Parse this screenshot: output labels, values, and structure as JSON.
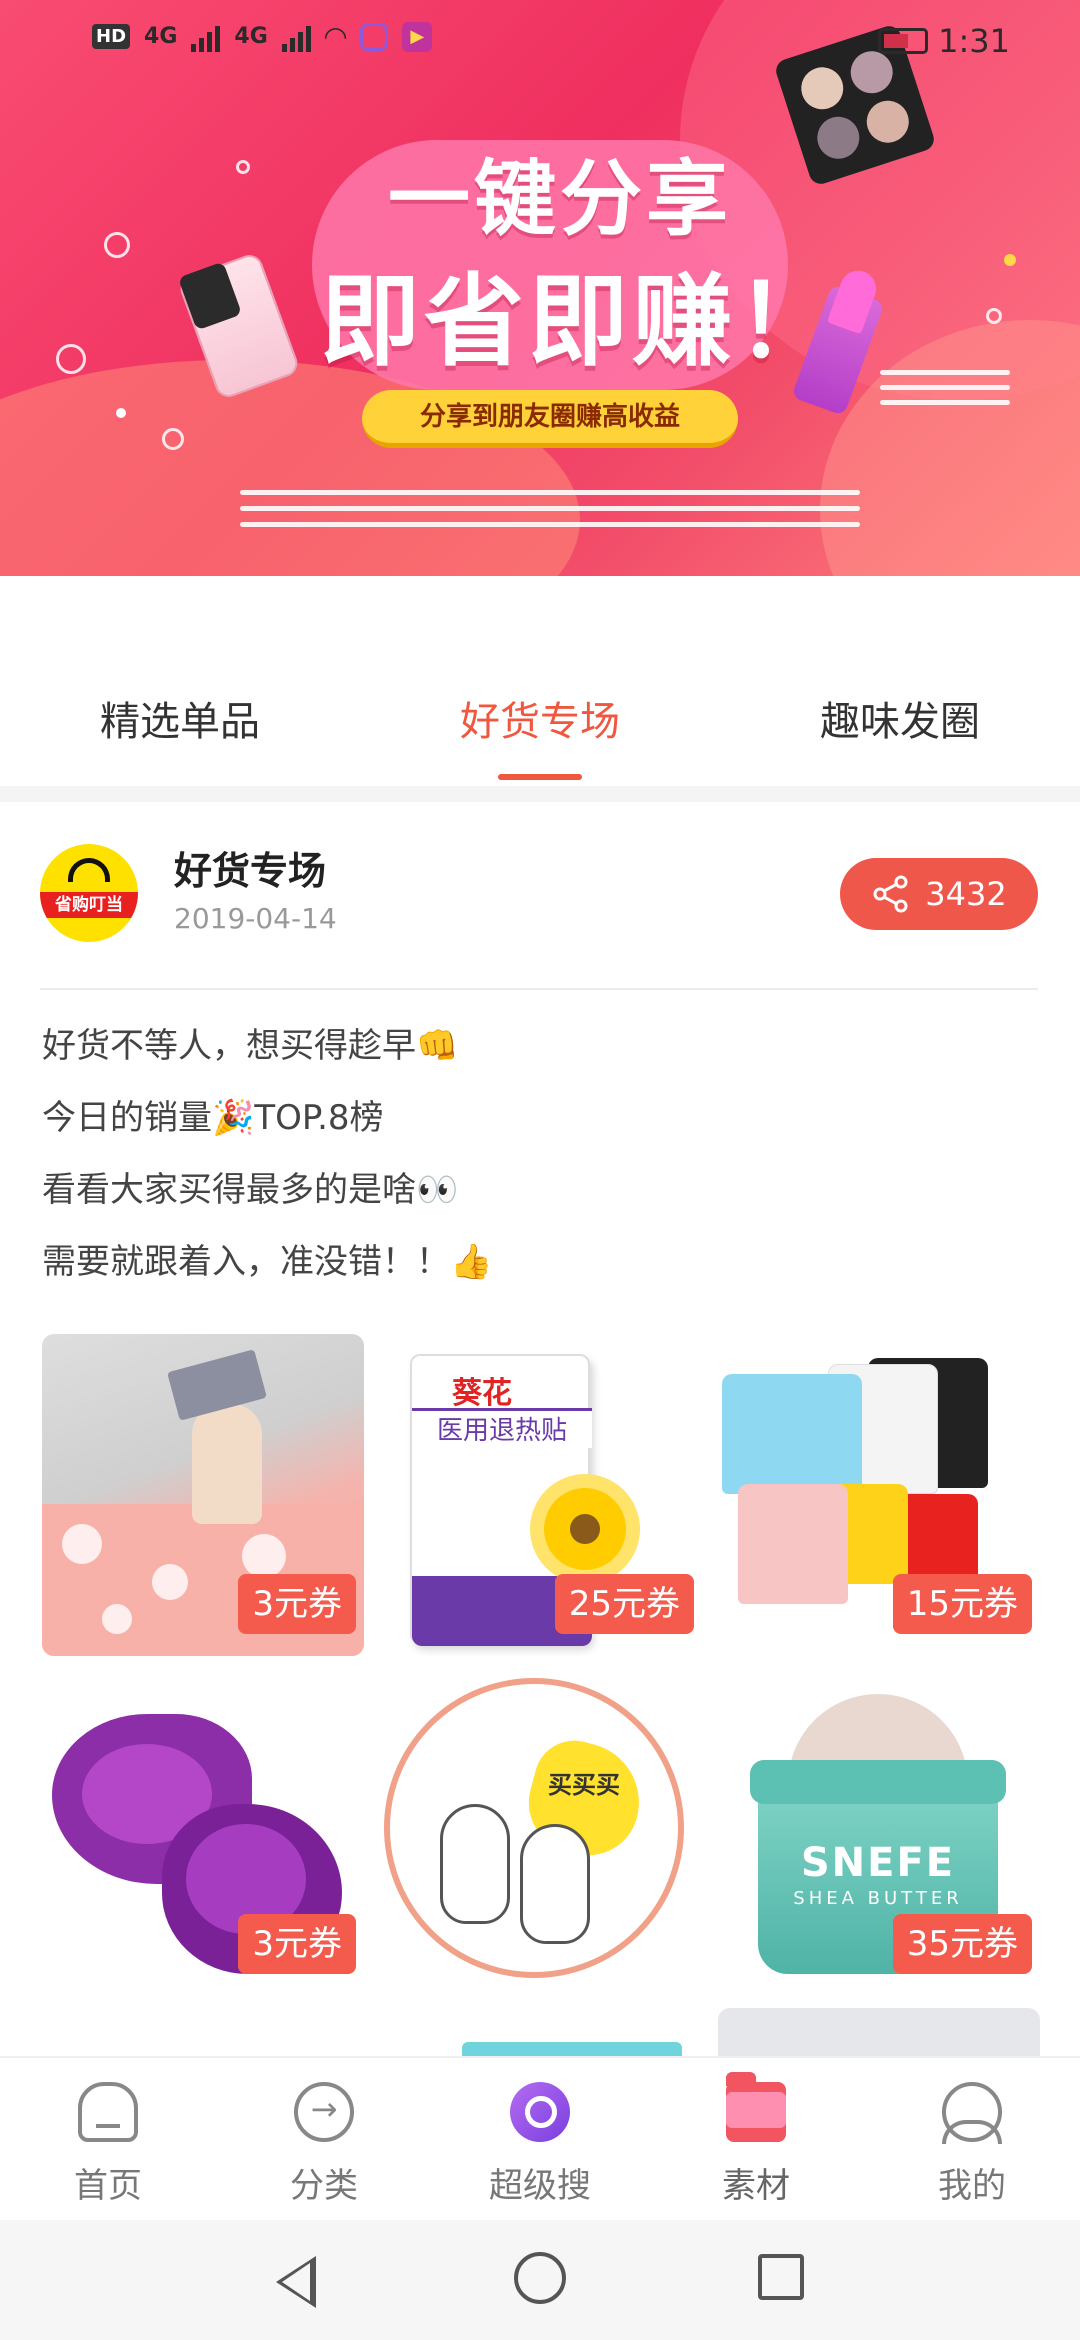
{
  "status_bar": {
    "hd": "HD",
    "network1": "4G",
    "network2": "4G",
    "time": "1:31"
  },
  "banner": {
    "headline_line1": "一键分享",
    "headline_line2": "即省即赚！",
    "subtitle": "分享到朋友圈赚高收益"
  },
  "tabs": [
    {
      "label": "精选单品",
      "active": false
    },
    {
      "label": "好货专场",
      "active": true
    },
    {
      "label": "趣味发圈",
      "active": false
    }
  ],
  "post": {
    "avatar_text": "省购叮当",
    "title": "好货专场",
    "date": "2019-04-14",
    "share_count": "3432",
    "lines": [
      "好货不等人，想买得趁早👊",
      "今日的销量🎉TOP.8榜",
      "看看大家买得最多的是啥👀",
      "需要就跟着入，准没错！！👍"
    ]
  },
  "products": [
    {
      "coupon": "3元券"
    },
    {
      "coupon": "25元券",
      "box_brand": "葵花",
      "box_title": "医用退热贴"
    },
    {
      "coupon": "15元券"
    },
    {
      "coupon": "3元券"
    },
    {
      "buy_text": "买买买"
    },
    {
      "coupon": "35元券",
      "jar_brand": "SNEFE",
      "jar_sub": "SHEA BUTTER"
    }
  ],
  "bottom_nav": [
    {
      "label": "首页",
      "icon": "home-icon"
    },
    {
      "label": "分类",
      "icon": "category-icon"
    },
    {
      "label": "超级搜",
      "icon": "super-search-icon"
    },
    {
      "label": "素材",
      "icon": "folder-icon"
    },
    {
      "label": "我的",
      "icon": "profile-icon"
    }
  ],
  "colors": {
    "accent": "#f0573f",
    "coupon": "#f45b4d",
    "banner": "#ef2f5f"
  }
}
